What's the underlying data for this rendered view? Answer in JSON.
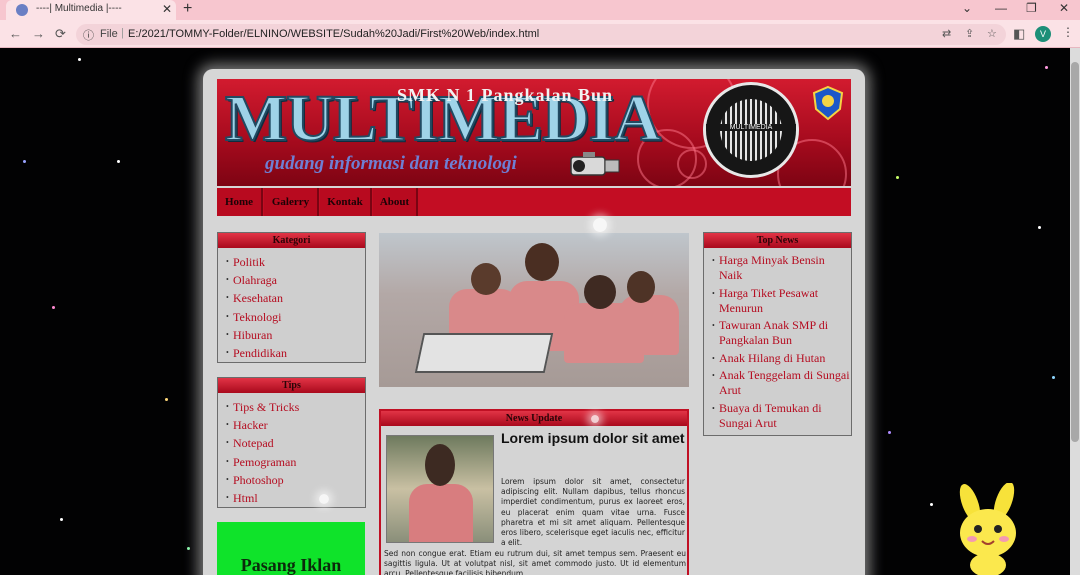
{
  "browser": {
    "tab_title": "----| Multimedia |----",
    "tab_close": "✕",
    "new_tab": "+",
    "window_controls": [
      "⌄",
      "—",
      "❐",
      "✕"
    ],
    "nav_icons": [
      "back-icon",
      "forward-icon",
      "reload-icon"
    ],
    "nav_glyphs": [
      "←",
      "→",
      "⟳"
    ],
    "info_glyph": "ⓘ",
    "omnibox_label": "File",
    "url": "E:/2021/TOMMY-Folder/ELNINO/WEBSITE/Sudah%20Jadi/First%20Web/index.html",
    "omnibox_icons": [
      "translate-icon",
      "share-icon",
      "bookmark-star-icon"
    ],
    "omnibox_glyphs": [
      "⇄",
      "⇪",
      "☆"
    ],
    "sidepanel_glyph": "◧",
    "profile_initial": "V",
    "menu_glyph": "⋮",
    "accent": "#f7c6cf"
  },
  "site": {
    "header": {
      "school": "SMK N 1 Pangkalan Bun",
      "title": "MULTIMEDIA",
      "tagline": "gudang informasi dan teknologi",
      "badge_text": "MULTIMEDIA",
      "brand_colors": {
        "red": "#c30d23",
        "title_blue": "#9fd3e8"
      }
    },
    "nav": [
      "Home",
      "Galerry",
      "Kontak",
      "About"
    ],
    "kategori": {
      "title": "Kategori",
      "items": [
        "Politik",
        "Olahraga",
        "Kesehatan",
        "Teknologi",
        "Hiburan",
        "Pendidikan"
      ]
    },
    "tips": {
      "title": "Tips",
      "items": [
        "Tips & Tricks",
        "Hacker",
        "Notepad",
        "Pemograman",
        "Photoshop",
        "Html"
      ]
    },
    "ad": {
      "text": "Pasang Iklan"
    },
    "top_news": {
      "title": "Top News",
      "items": [
        "Harga Minyak Bensin Naik",
        "Harga Tiket Pesawat Menurun",
        "Tawuran Anak SMP di Pangkalan Bun",
        "Anak Hilang di Hutan",
        "Anak Tenggelam di Sungai Arut",
        "Buaya di Temukan di Sungai Arut"
      ]
    },
    "news_update": {
      "title": "News Update",
      "headline": "Lorem ipsum dolor sit amet",
      "body": "Lorem ipsum dolor sit amet, consectetur adipiscing elit. Nullam dapibus, tellus rhoncus imperdiet condimentum, purus ex laoreet eros, eu placerat enim quam vitae urna. Fusce pharetra et mi sit amet aliquam. Pellentesque eros libero, scelerisque eget iaculis nec, efficitur a elit.",
      "body_cont": "Sed non congue erat. Etiam eu rutrum dui, sit amet tempus sem. Praesent eu sagittis ligula. Ut at volutpat nisl, sit amet commodo justo. Ut id elementum arcu. Pellentesque facilisis bibendum"
    }
  }
}
